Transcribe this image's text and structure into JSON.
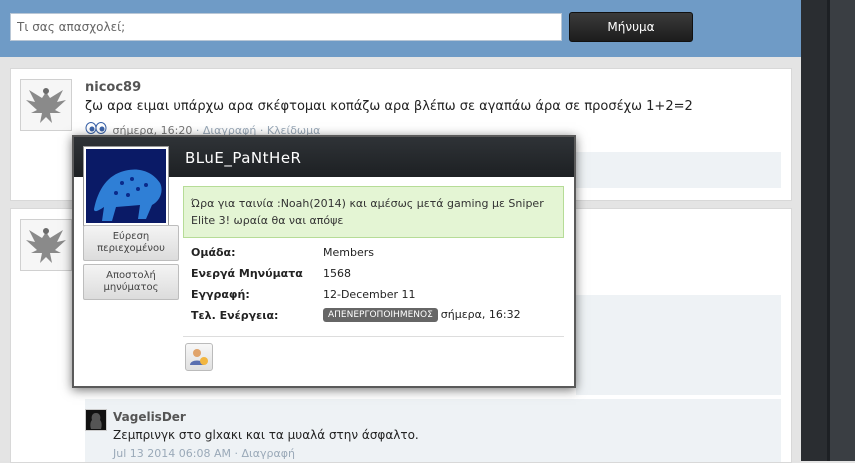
{
  "status_bar": {
    "placeholder": "Τι σας απασχολεί;",
    "post_button": "Μήνυμα"
  },
  "posts": [
    {
      "username": "nicoc89",
      "text": "ζω αρα ειμαι υπάρχω αρα σκέφτομαι κοπάζω αρα βλέπω σε αγαπάω άρα σε προσέχω 1+2=2",
      "time": "σήμερα, 16:20",
      "delete": "Διαγραφή",
      "lock": "Κλείδωμα"
    }
  ],
  "comment": {
    "username": "VagelisDer",
    "text": "Ζεμπρινγκ στο glxακι και τα μυαλά στην άσφαλτο.",
    "time": "Jul 13 2014 06:08 AM",
    "delete": "Διαγραφή"
  },
  "popup": {
    "name": "BLuE_PaNtHeR",
    "status": "Ώρα για ταινία :Noah(2014) και αμέσως μετά gaming με Sniper Elite 3! ωραία θα ναι απόψε",
    "find_content_button": "Εύρεση περιεχομένου",
    "send_message_button": "Αποστολή μηνύματος",
    "info": [
      {
        "label": "Ομάδα:",
        "value": "Members"
      },
      {
        "label": "Ενεργά Μηνύματα",
        "value": "1568"
      },
      {
        "label": "Εγγραφή:",
        "value": "12-December 11"
      },
      {
        "label": "Τελ. Ενέργεια:",
        "badge": "ΑΠΕΝΕΡΓΟΠΟΙΗΜΕΝΟΣ",
        "value": "σήμερα, 16:32"
      }
    ]
  },
  "colors": {
    "header_blue": "#6f9bc6",
    "popup_header": "#23272a",
    "status_green": "#e4f5d4"
  }
}
